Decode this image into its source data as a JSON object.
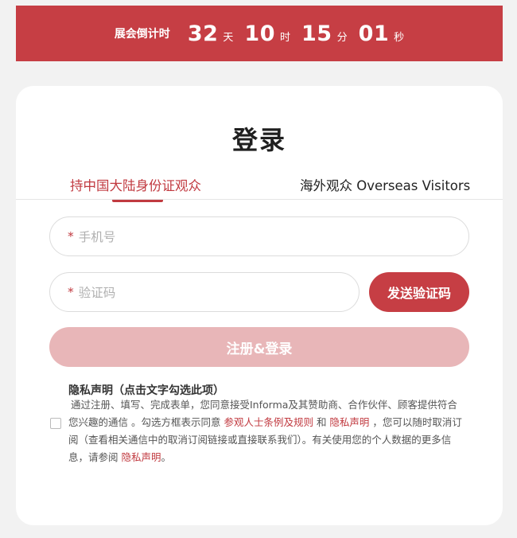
{
  "countdown": {
    "label": "展会倒计时",
    "days": "32",
    "days_unit": "天",
    "hours": "10",
    "hours_unit": "时",
    "minutes": "15",
    "minutes_unit": "分",
    "seconds": "01",
    "seconds_unit": "秒"
  },
  "login": {
    "title": "登录",
    "tabs": [
      {
        "label": "持中国大陆身份证观众",
        "active": true
      },
      {
        "label": "海外观众 Overseas Visitors",
        "active": false
      }
    ],
    "phone_field": {
      "required_mark": "*",
      "placeholder": "手机号"
    },
    "code_field": {
      "required_mark": "*",
      "placeholder": "验证码"
    },
    "send_code_label": "发送验证码",
    "submit_label": "注册&登录"
  },
  "privacy": {
    "title": "隐私声明（点击文字勾选此项）",
    "text_part1": "通过注册、填写、完成表单，您同意接受Informa及其赞助商、合作伙伴、顾客提供符合您兴趣的通信 。勾选方框表示同意 ",
    "link1": "参观人士条例及规则",
    "text_part2": " 和 ",
    "link2": "隐私声明",
    "text_part3": " ，您可以随时取消订阅（查看相关通信中的取消订阅链接或直接联系我们）。有关使用您的个人数据的更多信息，请参阅 ",
    "link3": "隐私声明",
    "text_part4": "。"
  },
  "colors": {
    "brand_red": "#c63e44",
    "submit_disabled": "#e8b6b8",
    "background": "#f2f2f2"
  }
}
